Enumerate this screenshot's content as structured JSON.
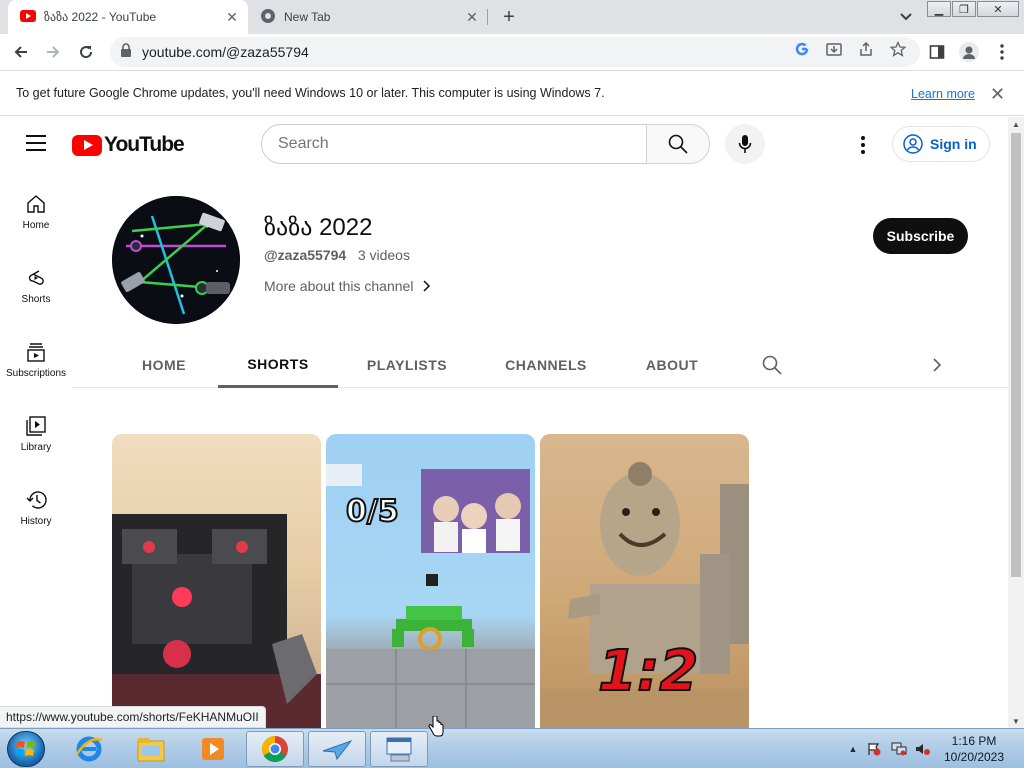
{
  "browser": {
    "tabs": [
      {
        "title": "ზაზა 2022 - YouTube",
        "active": true
      },
      {
        "title": "New Tab",
        "active": false
      }
    ],
    "new_tab_symbol": "+",
    "url": "youtube.com/@zaza55794",
    "infobar": {
      "message": "To get future Google Chrome updates, you'll need Windows 10 or later. This computer is using Windows 7.",
      "learn_more": "Learn more"
    },
    "status_url": "https://www.youtube.com/shorts/FeKHANMuOII"
  },
  "youtube": {
    "logo_text": "YouTube",
    "search_placeholder": "Search",
    "sign_in": "Sign in",
    "guide": [
      {
        "label": "Home",
        "icon": "home-icon"
      },
      {
        "label": "Shorts",
        "icon": "shorts-icon"
      },
      {
        "label": "Subscriptions",
        "icon": "subscriptions-icon"
      },
      {
        "label": "Library",
        "icon": "library-icon"
      },
      {
        "label": "History",
        "icon": "history-icon"
      }
    ],
    "channel": {
      "name": "ზაზა 2022",
      "handle": "@zaza55794",
      "video_count": "3 videos",
      "more_about": "More about this channel",
      "subscribe": "Subscribe"
    },
    "channel_tabs": [
      "HOME",
      "SHORTS",
      "PLAYLISTS",
      "CHANNELS",
      "ABOUT"
    ],
    "active_tab": "SHORTS",
    "shorts": [
      {
        "overlay_text": ""
      },
      {
        "overlay_text": "0/5"
      },
      {
        "overlay_text": "1:2"
      }
    ]
  },
  "taskbar": {
    "time": "1:16 PM",
    "date": "10/20/2023"
  },
  "colors": {
    "youtube_red": "#ff0000",
    "link_blue": "#065fd4",
    "chrome_tabstrip": "#dfe1e5"
  }
}
